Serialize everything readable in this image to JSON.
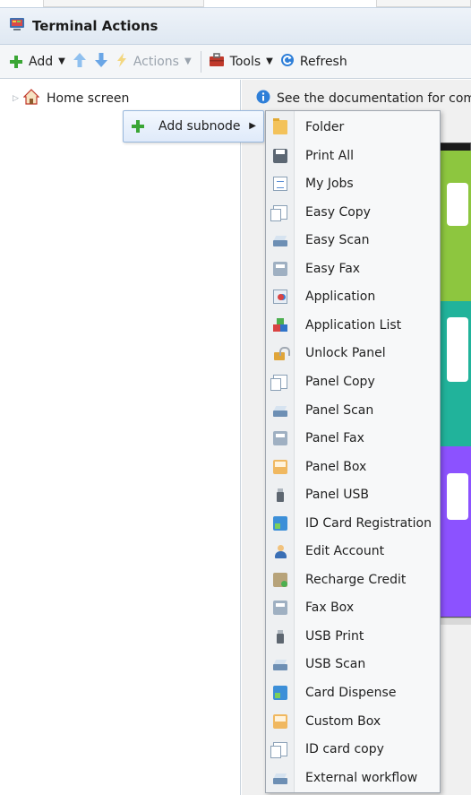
{
  "window": {
    "title": "Terminal Actions"
  },
  "toolbar": {
    "add_label": "Add",
    "actions_label": "Actions",
    "tools_label": "Tools",
    "refresh_label": "Refresh"
  },
  "tree": {
    "root_label": "Home screen"
  },
  "info": {
    "text": "See the documentation for com"
  },
  "context_menu": {
    "add_subnode_label": "Add subnode"
  },
  "submenu": {
    "items": [
      {
        "label": "Folder",
        "icon": "folder-icon"
      },
      {
        "label": "Print All",
        "icon": "printer-icon"
      },
      {
        "label": "My Jobs",
        "icon": "document-icon"
      },
      {
        "label": "Easy Copy",
        "icon": "copy-icon"
      },
      {
        "label": "Easy Scan",
        "icon": "scanner-icon"
      },
      {
        "label": "Easy Fax",
        "icon": "fax-icon"
      },
      {
        "label": "Application",
        "icon": "application-icon"
      },
      {
        "label": "Application List",
        "icon": "application-list-icon"
      },
      {
        "label": "Unlock Panel",
        "icon": "unlock-icon"
      },
      {
        "label": "Panel Copy",
        "icon": "copy-icon"
      },
      {
        "label": "Panel Scan",
        "icon": "scanner-icon"
      },
      {
        "label": "Panel Fax",
        "icon": "fax-icon"
      },
      {
        "label": "Panel Box",
        "icon": "box-icon"
      },
      {
        "label": "Panel USB",
        "icon": "usb-icon"
      },
      {
        "label": "ID Card Registration",
        "icon": "id-card-icon"
      },
      {
        "label": "Edit Account",
        "icon": "account-icon"
      },
      {
        "label": "Recharge Credit",
        "icon": "credit-icon"
      },
      {
        "label": "Fax Box",
        "icon": "fax-icon"
      },
      {
        "label": "USB Print",
        "icon": "usb-icon"
      },
      {
        "label": "USB Scan",
        "icon": "scanner-icon"
      },
      {
        "label": "Card Dispense",
        "icon": "id-card-icon"
      },
      {
        "label": "Custom Box",
        "icon": "box-icon"
      },
      {
        "label": "ID card copy",
        "icon": "copy-icon"
      },
      {
        "label": "External workflow",
        "icon": "scanner-icon"
      }
    ]
  },
  "colors": {
    "preview_green": "#8dc63f",
    "preview_teal": "#21b39b",
    "preview_purple": "#8c52ff",
    "add_green": "#3aa635",
    "refresh_blue": "#2f7fd8",
    "tools_red": "#c0392b"
  }
}
